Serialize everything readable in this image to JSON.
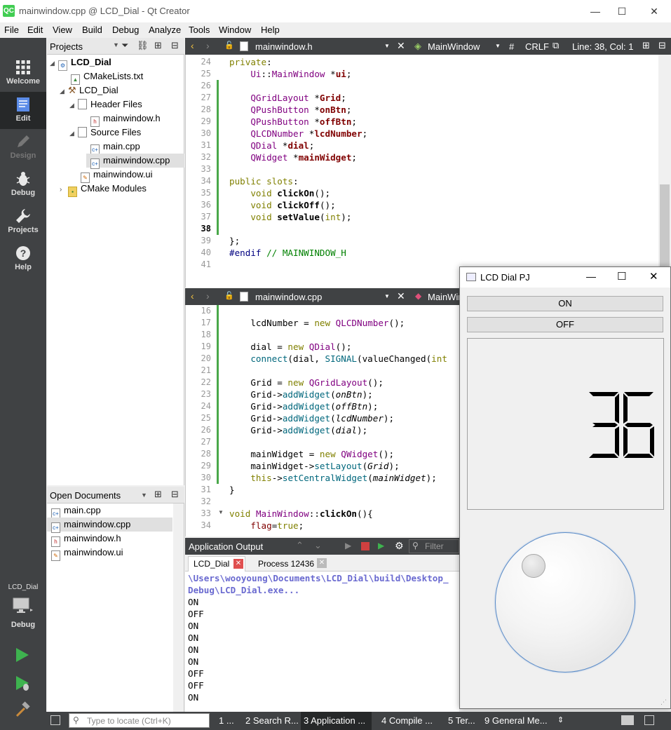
{
  "window": {
    "title": "mainwindow.cpp @ LCD_Dial - Qt Creator",
    "logo": "QC",
    "minimize": "—",
    "maximize": "☐",
    "close": "✕"
  },
  "menu": [
    "File",
    "Edit",
    "View",
    "Build",
    "Debug",
    "Analyze",
    "Tools",
    "Window",
    "Help"
  ],
  "modes": [
    {
      "label": "Welcome",
      "icon": "grid-icon"
    },
    {
      "label": "Edit",
      "icon": "document-icon"
    },
    {
      "label": "Design",
      "icon": "pen-icon"
    },
    {
      "label": "Debug",
      "icon": "bug-icon"
    },
    {
      "label": "Projects",
      "icon": "wrench-icon"
    },
    {
      "label": "Help",
      "icon": "help-icon"
    }
  ],
  "kit": {
    "project": "LCD_Dial",
    "config": "Debug"
  },
  "projects_panel": {
    "title": "Projects",
    "tree": [
      {
        "label": "LCD_Dial",
        "bold": true
      },
      {
        "label": "CMakeLists.txt"
      },
      {
        "label": "LCD_Dial"
      },
      {
        "label": "Header Files"
      },
      {
        "label": "mainwindow.h"
      },
      {
        "label": "Source Files"
      },
      {
        "label": "main.cpp"
      },
      {
        "label": "mainwindow.cpp",
        "selected": true
      },
      {
        "label": "mainwindow.ui"
      },
      {
        "label": "CMake Modules"
      }
    ]
  },
  "open_documents": {
    "title": "Open Documents",
    "items": [
      {
        "label": "main.cpp"
      },
      {
        "label": "mainwindow.cpp",
        "selected": true
      },
      {
        "label": "mainwindow.h"
      },
      {
        "label": "mainwindow.ui"
      }
    ]
  },
  "top_editor": {
    "file": "mainwindow.h",
    "symbol": "MainWindow",
    "hash": "#",
    "line_ending": "CRLF",
    "position": "Line: 38, Col: 1",
    "line_numbers": [
      "24",
      "25",
      "26",
      "27",
      "28",
      "29",
      "30",
      "31",
      "32",
      "33",
      "34",
      "35",
      "36",
      "37",
      "38",
      "39",
      "40",
      "41"
    ]
  },
  "bottom_editor": {
    "file": "mainwindow.cpp",
    "symbol": "MainWin",
    "line_numbers": [
      "16",
      "17",
      "18",
      "19",
      "20",
      "21",
      "22",
      "23",
      "24",
      "25",
      "26",
      "27",
      "28",
      "29",
      "30",
      "31",
      "32",
      "33",
      "34"
    ]
  },
  "output": {
    "title": "Application Output",
    "filter_placeholder": "Filter",
    "tabs": [
      "LCD_Dial",
      "Process 12436"
    ],
    "path1": "\\Users\\wooyoung\\Documents\\LCD_Dial\\build\\Desktop_",
    "path2": "Debug\\LCD_Dial.exe...",
    "lines": [
      "ON",
      "OFF",
      "ON",
      "ON",
      "ON",
      "ON",
      "OFF",
      "OFF",
      "ON"
    ]
  },
  "lcd_window": {
    "title": "LCD Dial PJ",
    "on_label": "ON",
    "off_label": "OFF",
    "lcd_value": "36"
  },
  "statusbar": {
    "locate_placeholder": "Type to locate (Ctrl+K)",
    "items": [
      "1 ...",
      "2  Search R...",
      "3  Application ...",
      "4  Compile ...",
      "5  Ter...",
      "9  General Me..."
    ]
  }
}
